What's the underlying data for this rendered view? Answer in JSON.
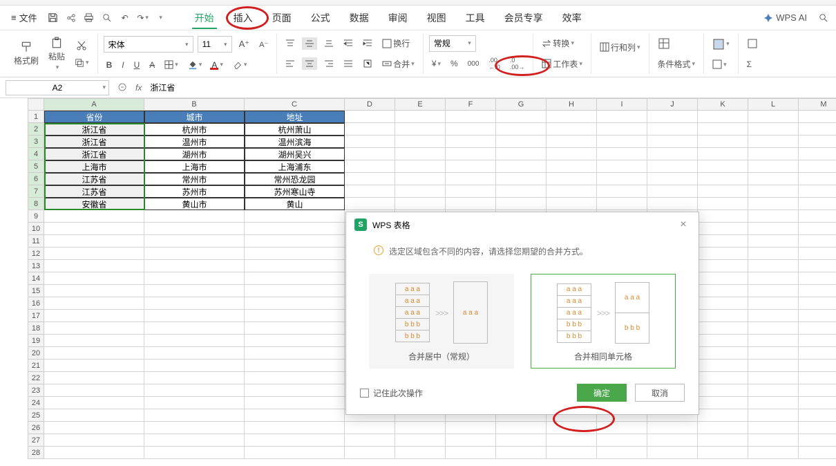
{
  "menu": {
    "file": "文件",
    "tabs": [
      "开始",
      "插入",
      "页面",
      "公式",
      "数据",
      "审阅",
      "视图",
      "工具",
      "会员专享",
      "效率"
    ],
    "wps_ai": "WPS AI"
  },
  "ribbon": {
    "format_painter": "格式刷",
    "paste": "粘贴",
    "font_name": "宋体",
    "font_size": "11",
    "wrap": "换行",
    "merge": "合并",
    "num_format": "常规",
    "convert": "转换",
    "rowcol": "行和列",
    "worksheet": "工作表",
    "cond_format": "条件格式"
  },
  "formula_bar": {
    "cell_ref": "A2",
    "value": "浙江省"
  },
  "columns": [
    "A",
    "B",
    "C",
    "D",
    "E",
    "F",
    "G",
    "H",
    "I",
    "J",
    "K",
    "L",
    "M"
  ],
  "table": {
    "headers": [
      "省份",
      "城市",
      "地址"
    ],
    "rows": [
      [
        "浙江省",
        "杭州市",
        "杭州萧山"
      ],
      [
        "浙江省",
        "温州市",
        "温州滨海"
      ],
      [
        "浙江省",
        "湖州市",
        "湖州吴兴"
      ],
      [
        "上海市",
        "上海市",
        "上海浦东"
      ],
      [
        "江苏省",
        "常州市",
        "常州恐龙园"
      ],
      [
        "江苏省",
        "苏州市",
        "苏州寒山寺"
      ],
      [
        "安徽省",
        "黄山市",
        "黄山"
      ]
    ]
  },
  "dialog": {
    "title": "WPS 表格",
    "message": "选定区域包含不同的内容，请选择您期望的合并方式。",
    "sample_a": "a a a",
    "sample_b": "b b b",
    "opt1_label": "合并居中（常规）",
    "opt2_label": "合并相同单元格",
    "remember": "记住此次操作",
    "ok": "确定",
    "cancel": "取消"
  }
}
